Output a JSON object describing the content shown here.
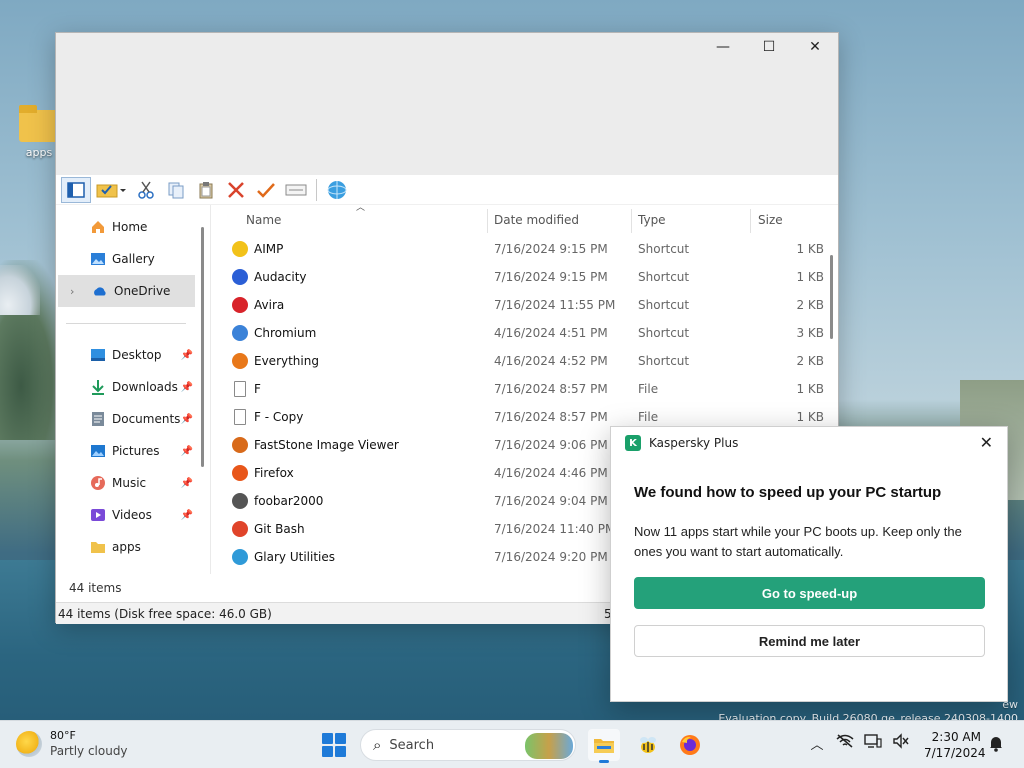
{
  "desktop": {
    "icon_label": "apps",
    "watermark_line1": "ew",
    "watermark_line2": "Evaluation copy. Build 26080.ge_release.240308-1400"
  },
  "window": {
    "minimize": "—",
    "maximize": "☐",
    "close": "✕"
  },
  "toolbar": {
    "icons": [
      "panes-icon",
      "select-all-icon",
      "cut-icon",
      "copy-icon",
      "paste-icon",
      "delete-icon",
      "check-icon",
      "rename-icon",
      "network-icon"
    ]
  },
  "sidebar": {
    "items": [
      {
        "label": "Home",
        "icon": "home-icon",
        "pin": false
      },
      {
        "label": "Gallery",
        "icon": "gallery-icon",
        "pin": false
      },
      {
        "label": "OneDrive",
        "icon": "cloud-icon",
        "pin": false,
        "selected": true
      },
      {
        "label": "Desktop",
        "icon": "desktop-icon",
        "pin": true
      },
      {
        "label": "Downloads",
        "icon": "download-icon",
        "pin": true
      },
      {
        "label": "Documents",
        "icon": "documents-icon",
        "pin": true
      },
      {
        "label": "Pictures",
        "icon": "pictures-icon",
        "pin": true
      },
      {
        "label": "Music",
        "icon": "music-icon",
        "pin": true
      },
      {
        "label": "Videos",
        "icon": "videos-icon",
        "pin": true
      },
      {
        "label": "apps",
        "icon": "folder-icon",
        "pin": false
      }
    ]
  },
  "filelist": {
    "columns": {
      "name": "Name",
      "date": "Date modified",
      "type": "Type",
      "size": "Size"
    },
    "rows": [
      {
        "name": "AIMP",
        "date": "7/16/2024 9:15 PM",
        "type": "Shortcut",
        "size": "1 KB",
        "color": "#f2c21a"
      },
      {
        "name": "Audacity",
        "date": "7/16/2024 9:15 PM",
        "type": "Shortcut",
        "size": "1 KB",
        "color": "#2b5fd6"
      },
      {
        "name": "Avira",
        "date": "7/16/2024 11:55 PM",
        "type": "Shortcut",
        "size": "2 KB",
        "color": "#d8232a"
      },
      {
        "name": "Chromium",
        "date": "4/16/2024 4:51 PM",
        "type": "Shortcut",
        "size": "3 KB",
        "color": "#3b82d8"
      },
      {
        "name": "Everything",
        "date": "4/16/2024 4:52 PM",
        "type": "Shortcut",
        "size": "2 KB",
        "color": "#e8781a"
      },
      {
        "name": "F",
        "date": "7/16/2024 8:57 PM",
        "type": "File",
        "size": "1 KB",
        "color": "file"
      },
      {
        "name": "F - Copy",
        "date": "7/16/2024 8:57 PM",
        "type": "File",
        "size": "1 KB",
        "color": "file"
      },
      {
        "name": "FastStone Image Viewer",
        "date": "7/16/2024 9:06 PM",
        "type": "",
        "size": "",
        "color": "#d86a1a"
      },
      {
        "name": "Firefox",
        "date": "4/16/2024 4:46 PM",
        "type": "",
        "size": "",
        "color": "#e8561a"
      },
      {
        "name": "foobar2000",
        "date": "7/16/2024 9:04 PM",
        "type": "",
        "size": "",
        "color": "#555555"
      },
      {
        "name": "Git Bash",
        "date": "7/16/2024 11:40 PM",
        "type": "",
        "size": "",
        "color": "#e0442a"
      },
      {
        "name": "Glary Utilities",
        "date": "7/16/2024 9:20 PM",
        "type": "",
        "size": "",
        "color": "#2f9ad8"
      }
    ]
  },
  "status": {
    "inner": "44 items",
    "bar": "44 items (Disk free space: 46.0 GB)",
    "bar_segment": "5"
  },
  "toast": {
    "app": "Kaspersky Plus",
    "logo_letter": "K",
    "close": "✕",
    "title": "We found how to speed up your PC startup",
    "text": "Now 11 apps start while your PC boots up. Keep only the ones you want to start automatically.",
    "primary": "Go to speed-up",
    "secondary": "Remind me later",
    "accent": "#24a17a"
  },
  "taskbar": {
    "temperature": "80°F",
    "condition": "Partly cloudy",
    "search": "Search",
    "time": "2:30 AM",
    "date": "7/17/2024"
  }
}
